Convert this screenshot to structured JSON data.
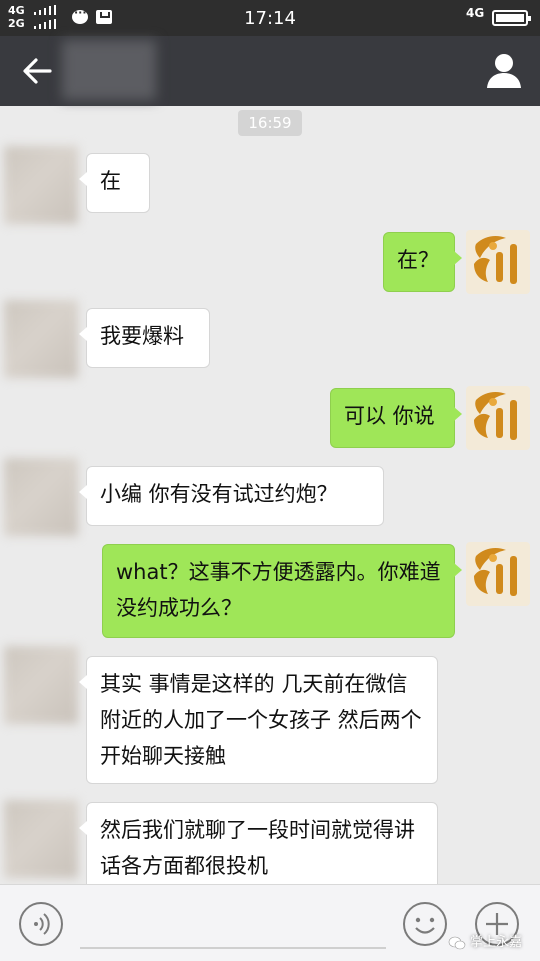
{
  "status_bar": {
    "network_top": "4G",
    "network_bottom": "2G",
    "time": "17:14",
    "network_right": "4G"
  },
  "chat": {
    "timestamp": "16:59",
    "messages": [
      {
        "side": "left",
        "text": "在"
      },
      {
        "side": "right",
        "text": "在？"
      },
      {
        "side": "left",
        "text": "我要爆料"
      },
      {
        "side": "right",
        "text": "可以 你说"
      },
      {
        "side": "left",
        "text": "小编 你有没有试过约炮？"
      },
      {
        "side": "right",
        "text": "what？这事不方便透露内。你难道没约成功么？"
      },
      {
        "side": "left",
        "text": "其实 事情是这样的 几天前在微信附近的人加了一个女孩子 然后两个开始聊天接触"
      },
      {
        "side": "left",
        "text": "然后我们就聊了一段时间就觉得讲话各方面都很投机"
      }
    ]
  },
  "watermark": {
    "text": "掌上永嘉"
  },
  "icons": {
    "back": "arrow-left-icon",
    "profile": "person-icon",
    "voice": "voice-icon",
    "emoji": "smiley-icon",
    "more": "plus-icon"
  },
  "colors": {
    "status_bar": "#2e2e2e",
    "title_bar": "#393a3f",
    "chat_background": "#ebebeb",
    "bubble_sent": "#9fe658",
    "bubble_received": "#ffffff",
    "input_bar": "#f4f4f6"
  }
}
